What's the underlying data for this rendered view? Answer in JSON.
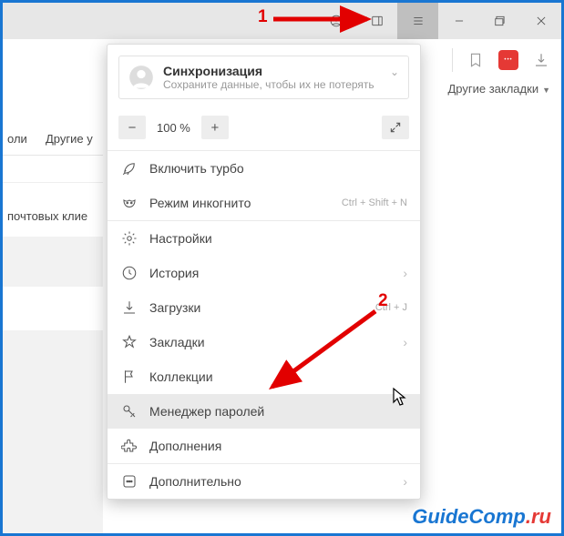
{
  "titlebar": {
    "profile_icon": "profile-icon",
    "ext_icon": "sidebar-icon",
    "menu_icon": "hamburger-icon",
    "min_icon": "minimize-icon",
    "max_icon": "maximize-icon",
    "close_icon": "close-icon"
  },
  "toolbar": {
    "bookmark_icon": "bookmark-flag-icon",
    "lastpass_icon": "lastpass-icon",
    "download_icon": "download-icon",
    "other_bookmarks": "Другие закладки"
  },
  "left": {
    "txt1": "оли",
    "txt2": "Другие у",
    "txt3": "почтовых клие"
  },
  "sync": {
    "title": "Синхронизация",
    "subtitle": "Сохраните данные, чтобы их не потерять"
  },
  "zoom": {
    "minus": "−",
    "value": "100 %",
    "plus": "+"
  },
  "menu": {
    "turbo": "Включить турбо",
    "incognito": "Режим инкогнито",
    "incognito_sc": "Ctrl + Shift + N",
    "settings": "Настройки",
    "history": "История",
    "downloads": "Загрузки",
    "downloads_sc": "Ctrl + J",
    "bookmarks": "Закладки",
    "collections": "Коллекции",
    "passwords": "Менеджер паролей",
    "addons": "Дополнения",
    "more": "Дополнительно"
  },
  "annotations": {
    "n1": "1",
    "n2": "2"
  },
  "watermark": {
    "a": "GuideComp",
    "b": ".ru"
  }
}
